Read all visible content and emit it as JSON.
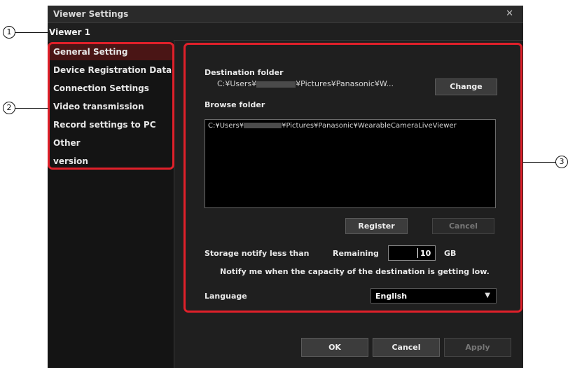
{
  "window": {
    "title": "Viewer Settings",
    "close_glyph": "✕"
  },
  "viewer_label": "Viewer 1",
  "annotations": {
    "marker1": "1",
    "marker2": "2",
    "marker3": "3",
    "callout_color": "#e0202a"
  },
  "sidebar": {
    "items": [
      {
        "label": "General Setting",
        "active": true
      },
      {
        "label": "Device Registration Data",
        "active": false
      },
      {
        "label": "Connection Settings",
        "active": false
      },
      {
        "label": "Video transmission",
        "active": false
      },
      {
        "label": "Record settings to PC",
        "active": false
      },
      {
        "label": "Other",
        "active": false
      },
      {
        "label": "version",
        "active": false
      }
    ]
  },
  "general": {
    "destination_folder_label": "Destination folder",
    "destination_prefix": "C:¥Users¥",
    "destination_suffix": "¥Pictures¥Panasonic¥W...",
    "change_button": "Change",
    "browse_folder_label": "Browse folder",
    "browse_prefix": "C:¥Users¥",
    "browse_suffix": "¥Pictures¥Panasonic¥WearableCameraLiveViewer",
    "register_button": "Register",
    "cancel_button": "Cancel",
    "storage_label": "Storage notify less than",
    "remaining_label": "Remaining",
    "remaining_value": "10",
    "unit": "GB",
    "notify_text": "Notify me when the capacity of the destination is getting low.",
    "language_label": "Language",
    "language_value": "English",
    "dropdown_icon": "▼"
  },
  "footer": {
    "ok": "OK",
    "cancel": "Cancel",
    "apply": "Apply"
  }
}
